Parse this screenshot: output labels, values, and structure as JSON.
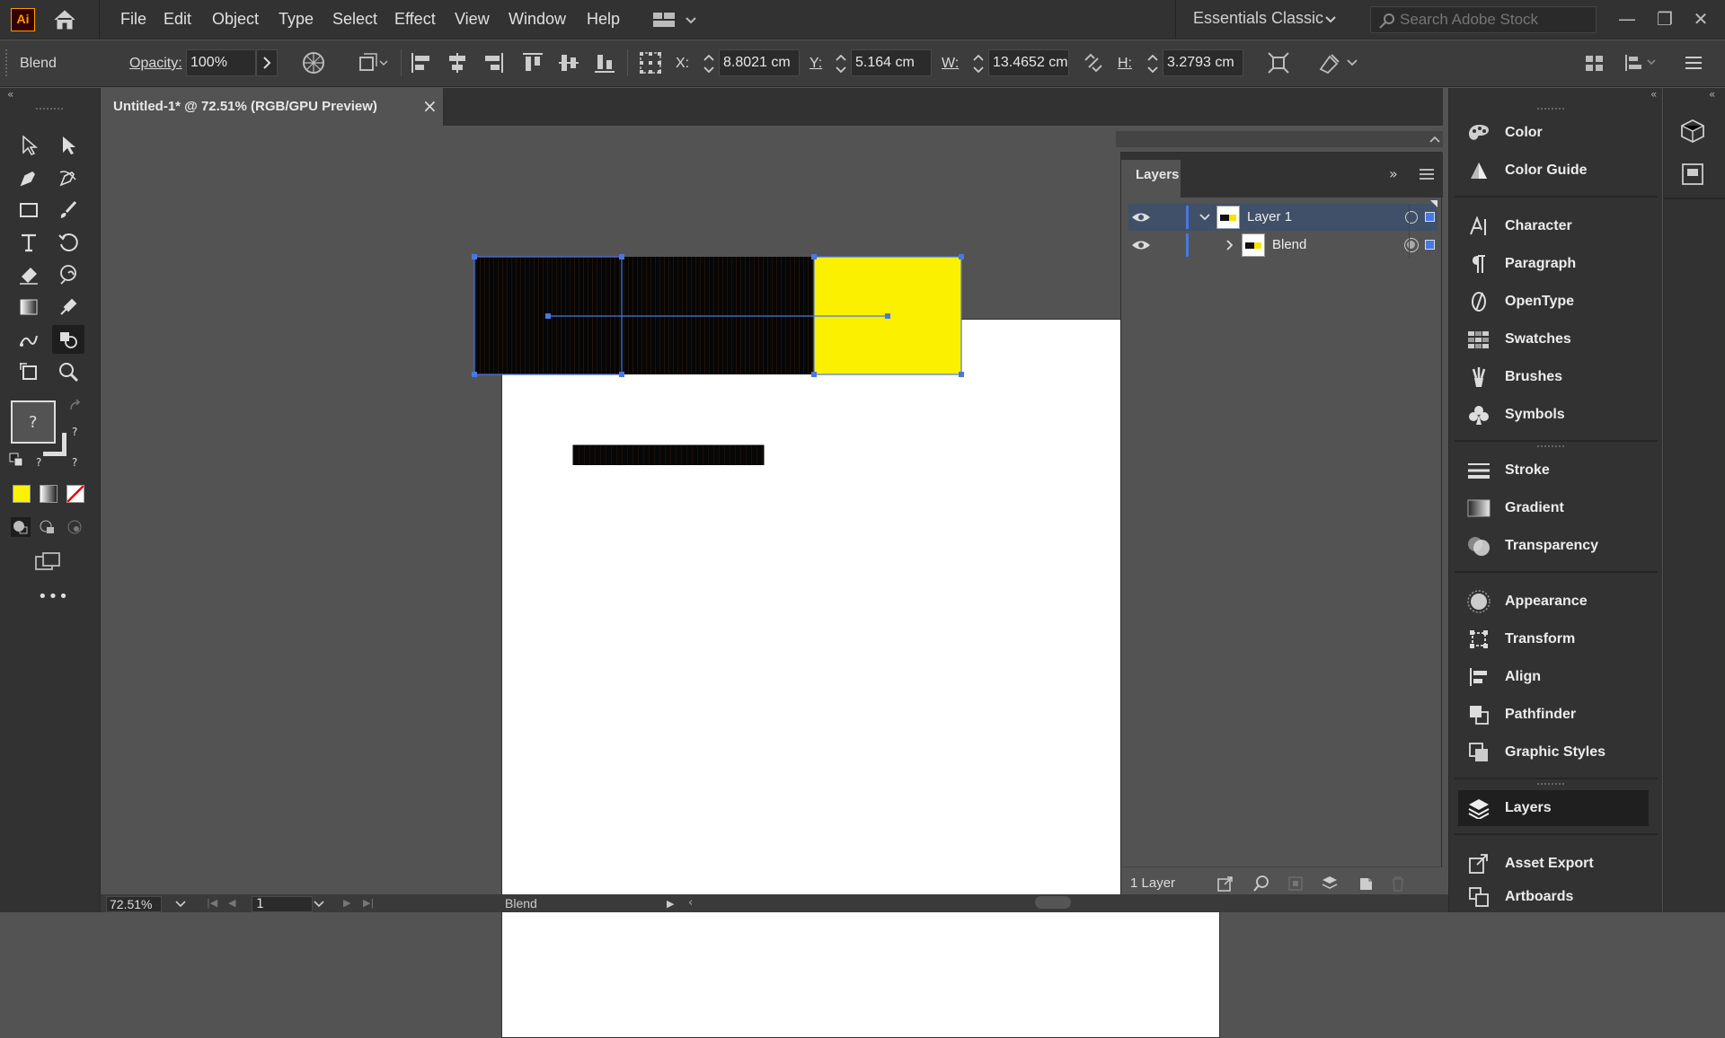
{
  "app": {
    "logo": "Ai",
    "menu": [
      "File",
      "Edit",
      "Object",
      "Type",
      "Select",
      "Effect",
      "View",
      "Window",
      "Help"
    ],
    "workspace": "Essentials Classic",
    "search_placeholder": "Search Adobe Stock"
  },
  "control_bar": {
    "selection_label": "Blend",
    "opacity_label": "Opacity:",
    "opacity_value": "100%",
    "x_label": "X:",
    "x_value": "8.8021 cm",
    "y_label": "Y:",
    "y_value": "5.164 cm",
    "w_label": "W:",
    "w_value": "13.4652 cm",
    "h_label": "H:",
    "h_value": "3.2793 cm"
  },
  "document": {
    "tab_title": "Untitled-1* @ 72.51% (RGB/GPU Preview)",
    "close_glyph": "×"
  },
  "artwork": {
    "left_color": "#050505",
    "right_color": "#fbf000",
    "selection_color": "#4a78e0"
  },
  "tools": {
    "fill_stroke_unknown": "?",
    "color_swatch": "#fff200"
  },
  "layers_panel": {
    "title": "Layers",
    "rows": [
      {
        "name": "Layer 1",
        "expanded": true,
        "selected": true
      },
      {
        "name": "Blend",
        "expanded": false,
        "selected": false
      }
    ],
    "footer_count": "1 Layer"
  },
  "right_dock": {
    "groups": [
      [
        "Color",
        "Color Guide"
      ],
      [
        "Character",
        "Paragraph",
        "OpenType",
        "Swatches",
        "Brushes",
        "Symbols"
      ],
      [
        "Stroke",
        "Gradient",
        "Transparency"
      ],
      [
        "Appearance",
        "Transform",
        "Align",
        "Pathfinder",
        "Graphic Styles"
      ],
      [
        "Layers"
      ],
      [
        "Asset Export",
        "Artboards"
      ]
    ],
    "active": "Layers"
  },
  "status_bar": {
    "zoom": "72.51%",
    "artboard_number": "1",
    "selection": "Blend"
  }
}
